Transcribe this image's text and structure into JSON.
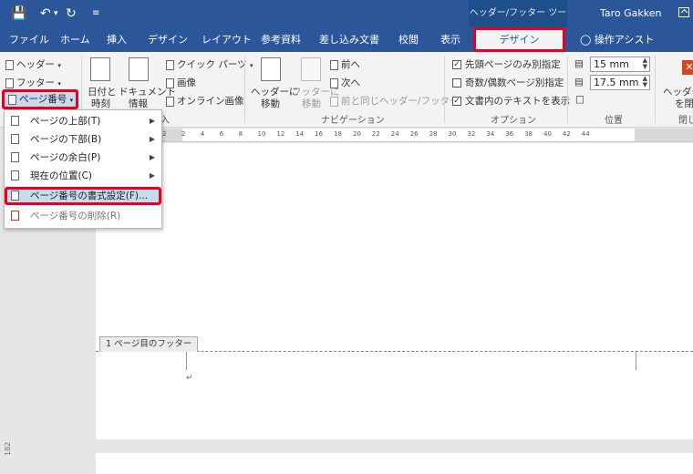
{
  "titlebar": {
    "context_title": "ヘッダー/フッター ツール",
    "user": "Taro Gakken"
  },
  "tabs": [
    {
      "label": "ファイル"
    },
    {
      "label": "ホーム"
    },
    {
      "label": "挿入"
    },
    {
      "label": "デザイン"
    },
    {
      "label": "レイアウト"
    },
    {
      "label": "参考資料"
    },
    {
      "label": "差し込み文書"
    },
    {
      "label": "校閲"
    },
    {
      "label": "表示"
    }
  ],
  "active_tab": "デザイン",
  "assist": "操作アシスト",
  "ribbon": {
    "header": "ヘッダー",
    "footer": "フッター",
    "page_number": "ページ番号",
    "date_time_1": "日付と",
    "date_time_2": "時刻",
    "document_info_1": "ドキュメント",
    "document_info_2": "情報",
    "quick_parts": "クイック パーツ",
    "picture": "画像",
    "online_picture": "オンライン画像",
    "insert_group_label": "入",
    "goto_header_1": "ヘッダーに",
    "goto_header_2": "移動",
    "goto_footer_1": "フッターに",
    "goto_footer_2": "移動",
    "prev": "前へ",
    "next": "次へ",
    "link_prev": "前と同じヘッダー/フッター",
    "navigation_label": "ナビゲーション",
    "opt_first_page": "先頭ページのみ別指定",
    "opt_odd_even": "奇数/偶数ページ別指定",
    "opt_show_text": "文書内のテキストを表示",
    "options_label": "オプション",
    "header_pos": "15 mm",
    "footer_pos": "17.5 mm",
    "position_label": "位置",
    "close_1": "ヘッダーと",
    "close_2": "を閉",
    "close_label": "閉じ"
  },
  "ruler": {
    "ticks": [
      "2",
      "2",
      "4",
      "6",
      "8",
      "10",
      "12",
      "14",
      "16",
      "18",
      "20",
      "22",
      "24",
      "26",
      "28",
      "30",
      "32",
      "34",
      "36",
      "38",
      "40",
      "42",
      "44"
    ]
  },
  "menu": {
    "top": "ページの上部(T)",
    "bottom": "ページの下部(B)",
    "margin": "ページの余白(P)",
    "current": "現在の位置(C)",
    "format": "ページ番号の書式設定(F)...",
    "remove": "ページ番号の削除(R)"
  },
  "document": {
    "footer_tag": "1 ページ目のフッター",
    "side_number": "182"
  },
  "colors": {
    "accent": "#2b579a",
    "highlight": "#e8001c"
  }
}
